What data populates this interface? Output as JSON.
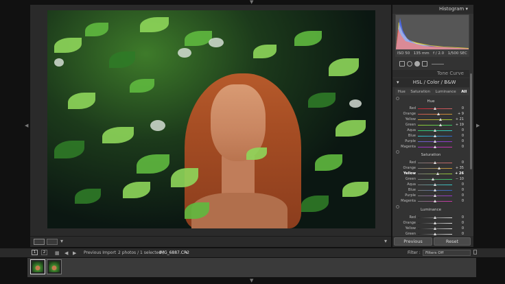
{
  "right_panel": {
    "histogram_title": "Histogram",
    "histogram_info": {
      "iso": "ISO 50",
      "focal": "135 mm",
      "aperture": "f / 2.0",
      "shutter": "1/500 SEC"
    },
    "tone_curve_title": "Tone Curve",
    "hsl_title": "HSL / Color / B&W",
    "hsl_tabs": [
      "Hue",
      "Saturation",
      "Luminance",
      "All"
    ],
    "groups": {
      "hue": {
        "label": "Hue",
        "rows": [
          {
            "name": "Red",
            "value": "0"
          },
          {
            "name": "Orange",
            "value": "+ 9"
          },
          {
            "name": "Yellow",
            "value": "+ 21"
          },
          {
            "name": "Green",
            "value": "+ 19"
          },
          {
            "name": "Aqua",
            "value": "0"
          },
          {
            "name": "Blue",
            "value": "0"
          },
          {
            "name": "Purple",
            "value": "0"
          },
          {
            "name": "Magenta",
            "value": "0"
          }
        ]
      },
      "saturation": {
        "label": "Saturation",
        "rows": [
          {
            "name": "Red",
            "value": "0"
          },
          {
            "name": "Orange",
            "value": "+ 35"
          },
          {
            "name": "Yellow",
            "value": "+ 26"
          },
          {
            "name": "Green",
            "value": "− 10"
          },
          {
            "name": "Aqua",
            "value": "0"
          },
          {
            "name": "Blue",
            "value": "0"
          },
          {
            "name": "Purple",
            "value": "0"
          },
          {
            "name": "Magenta",
            "value": "0"
          }
        ]
      },
      "luminance": {
        "label": "Luminance",
        "rows": [
          {
            "name": "Red",
            "value": "0"
          },
          {
            "name": "Orange",
            "value": "0"
          },
          {
            "name": "Yellow",
            "value": "0"
          },
          {
            "name": "Green",
            "value": "0"
          }
        ]
      }
    },
    "previous_label": "Previous",
    "reset_label": "Reset"
  },
  "filmbar": {
    "page1": "1",
    "page2": "2",
    "source": "Previous Import",
    "selection": "2 photos / 1 selected /",
    "filename": "IMG_6887.CR2",
    "filter_label": "Filter :",
    "filter_value": "Filters Off"
  },
  "colors": {
    "panel": "#333333",
    "panel_dark": "#2b2b2b",
    "accent_text": "#d8d8d8"
  },
  "icons": [
    "grid-icon",
    "loupe-icon",
    "left-arrow-icon",
    "right-arrow-icon",
    "crop-icon",
    "spot-removal-icon",
    "red-eye-icon",
    "gradient-icon",
    "brush-icon"
  ]
}
